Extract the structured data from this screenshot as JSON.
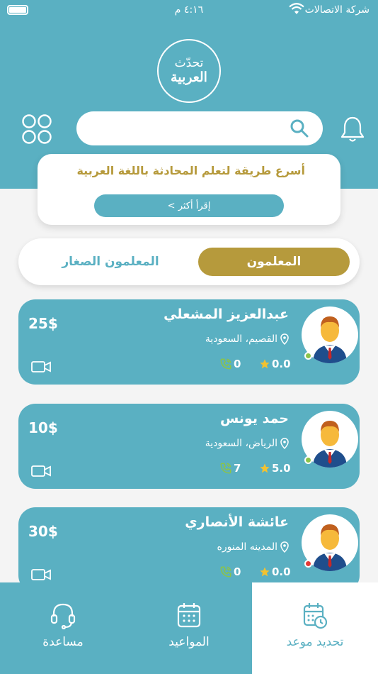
{
  "status_bar": {
    "carrier": "شركة الاتصالات",
    "time": "٤:١٦ م"
  },
  "logo": {
    "line1": "تحدّث",
    "line2": "العربية"
  },
  "search": {
    "placeholder": ""
  },
  "promo": {
    "title": "أسرع طريقة لتعلم المحادثة باللغة العربية",
    "button_label": "إقرأ أكثر >"
  },
  "tabs": {
    "active_label": "المعلمون",
    "inactive_label": "المعلمون الصغار"
  },
  "teachers": [
    {
      "name": "عبدالعزيز المشعلي",
      "location": "القصيم، السعودية",
      "price": "25$",
      "rating": "0.0",
      "calls": "0",
      "status_color": "#8bc34a"
    },
    {
      "name": "حمد يونس",
      "location": "الرياض، السعودية",
      "price": "10$",
      "rating": "5.0",
      "calls": "7",
      "status_color": "#8bc34a"
    },
    {
      "name": "عائشة الأنصاري",
      "location": "المدينه المنوره",
      "price": "30$",
      "rating": "0.0",
      "calls": "0",
      "status_color": "#e53935"
    }
  ],
  "bottom_nav": {
    "items": [
      {
        "label": "مساعدة",
        "icon": "headset-icon"
      },
      {
        "label": "المواعيد",
        "icon": "calendar-icon"
      },
      {
        "label": "تحديد موعد",
        "icon": "calendar-clock-icon"
      }
    ],
    "active_index": 2
  },
  "colors": {
    "primary": "#5ab0c2",
    "gold": "#b69a3c",
    "star": "#f2c230",
    "background": "#f4f4f4"
  }
}
